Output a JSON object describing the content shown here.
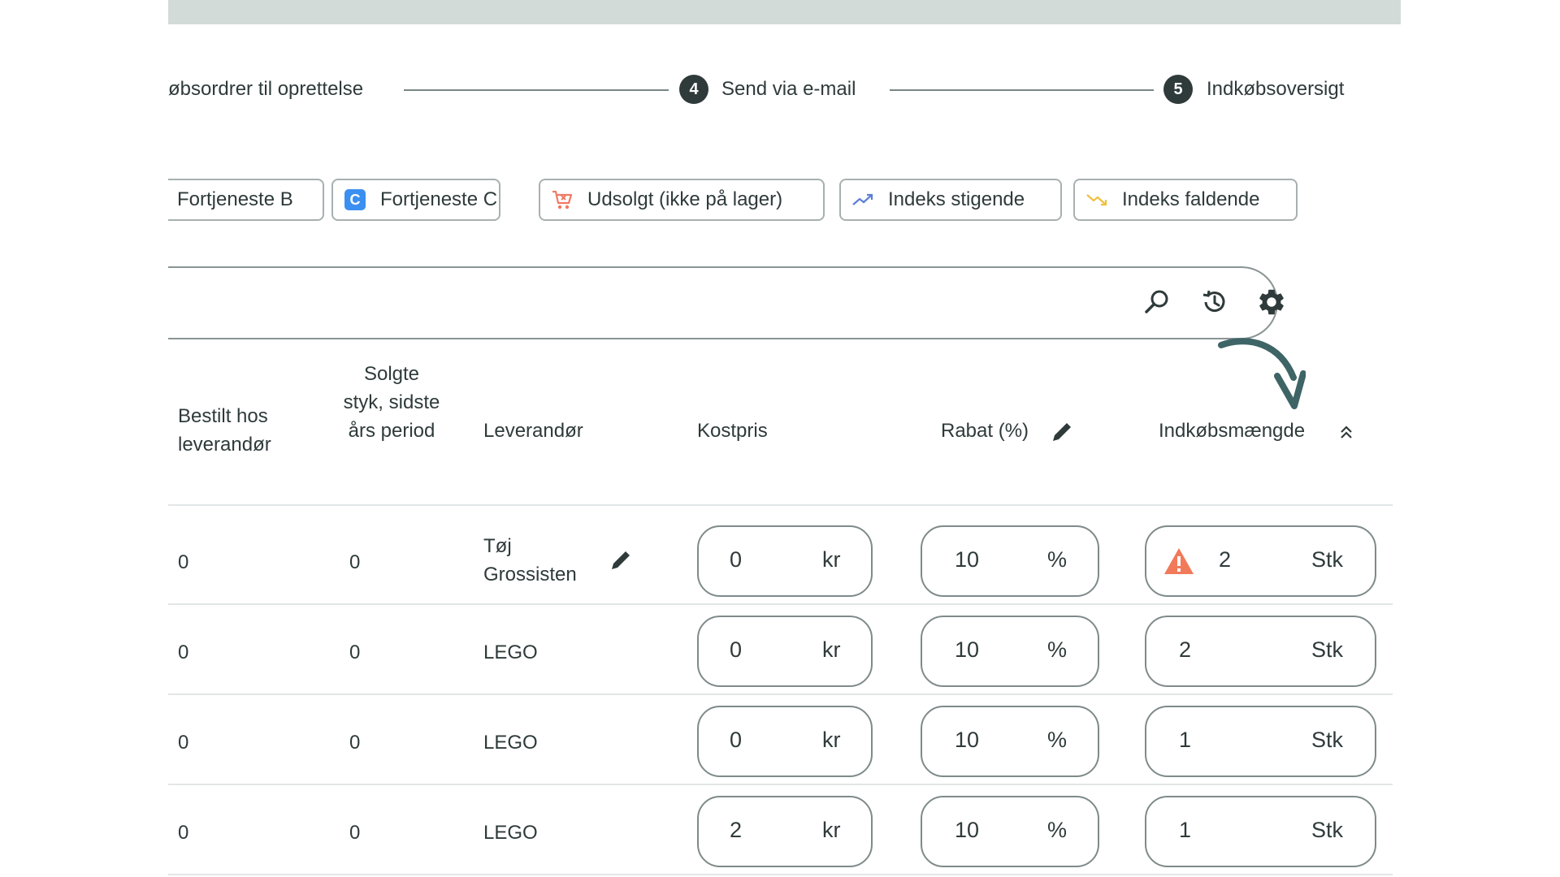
{
  "stepper": {
    "partial_step_label": "øbsordrer til oprettelse",
    "steps": [
      {
        "number": "4",
        "label": "Send via e-mail"
      },
      {
        "number": "5",
        "label": "Indkøbsoversigt"
      }
    ]
  },
  "filters": [
    {
      "label": "Fortjeneste B",
      "icon": "none"
    },
    {
      "label": "Fortjeneste C",
      "icon": "letter-c-badge-icon",
      "icon_text": "C",
      "color": "#3b8ff0"
    },
    {
      "label": "Udsolgt (ikke på lager)",
      "icon": "cart-icon",
      "color": "#f07a63"
    },
    {
      "label": "Indeks stigende",
      "icon": "trending-up-icon",
      "color": "#5b7fd6"
    },
    {
      "label": "Indeks faldende",
      "icon": "trending-down-icon",
      "color": "#f0c040"
    }
  ],
  "search": {
    "placeholder": ""
  },
  "toolbar": {
    "icons": [
      "search-icon",
      "history-icon",
      "gear-icon"
    ]
  },
  "table": {
    "headers": {
      "ordered": "Bestilt hos leverandør",
      "sold": "Solgte styk, sidste års period",
      "supplier": "Leverandør",
      "cost": "Kostpris",
      "discount": "Rabat (%)",
      "quantity": "Indkøbsmængde"
    },
    "rows": [
      {
        "ordered": "0",
        "sold": "0",
        "supplier": "Tøj Grossisten",
        "supplier_editable": true,
        "cost": "0",
        "cost_unit": "kr",
        "discount": "10",
        "discount_unit": "%",
        "quantity": "2",
        "quantity_unit": "Stk",
        "warning": true
      },
      {
        "ordered": "0",
        "sold": "0",
        "supplier": "LEGO",
        "supplier_editable": false,
        "cost": "0",
        "cost_unit": "kr",
        "discount": "10",
        "discount_unit": "%",
        "quantity": "2",
        "quantity_unit": "Stk",
        "warning": false
      },
      {
        "ordered": "0",
        "sold": "0",
        "supplier": "LEGO",
        "supplier_editable": false,
        "cost": "0",
        "cost_unit": "kr",
        "discount": "10",
        "discount_unit": "%",
        "quantity": "1",
        "quantity_unit": "Stk",
        "warning": false
      },
      {
        "ordered": "0",
        "sold": "0",
        "supplier": "LEGO",
        "supplier_editable": false,
        "cost": "2",
        "cost_unit": "kr",
        "discount": "10",
        "discount_unit": "%",
        "quantity": "1",
        "quantity_unit": "Stk",
        "warning": false
      }
    ]
  },
  "colors": {
    "accent_dark": "#2f3a3a",
    "annotation_arrow": "#3e6466",
    "warning": "#f07a5a"
  }
}
